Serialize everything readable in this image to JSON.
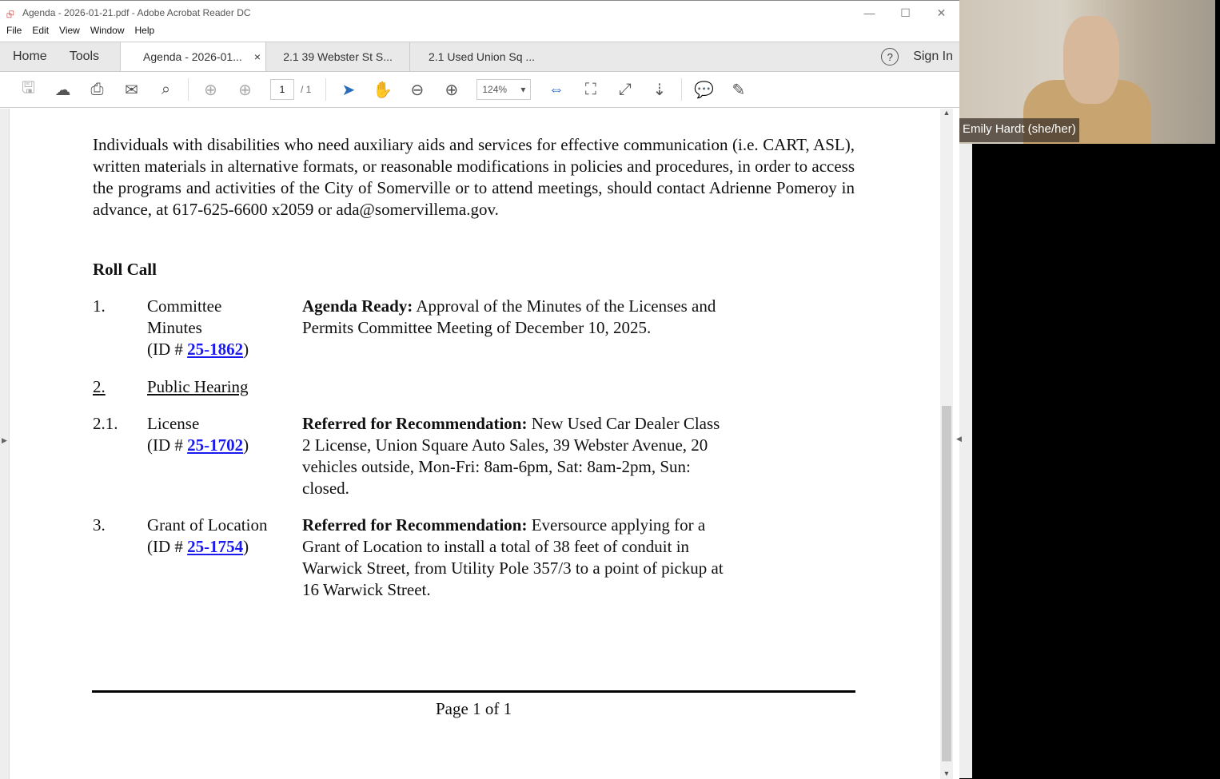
{
  "window": {
    "title": "Agenda - 2026-01-21.pdf - Adobe Acrobat Reader DC"
  },
  "menu": [
    "File",
    "Edit",
    "View",
    "Window",
    "Help"
  ],
  "tabs": {
    "home": "Home",
    "tools": "Tools",
    "docs": [
      "Agenda - 2026-01...",
      "2.1 39 Webster St S...",
      "2.1 Used Union Sq ..."
    ],
    "close": "×",
    "sign_in": "Sign In",
    "help": "?"
  },
  "toolbar": {
    "page_current": "1",
    "page_total": "/ 1",
    "zoom": "124%"
  },
  "doc": {
    "para": "Individuals with disabilities who need auxiliary aids and services for effective communication (i.e. CART, ASL), written materials in alternative formats, or reasonable modifications in policies and procedures, in order to access the programs and activities of the City of Somerville or to attend meetings, should contact Adrienne Pomeroy in advance, at 617-625-6600 x2059 or ada@somervillema.gov.",
    "roll_call": "Roll Call",
    "items": [
      {
        "num": "1.",
        "label1": "Committee",
        "label2": "Minutes",
        "id_prefix": "(ID # ",
        "id": "25-1862",
        "id_suffix": ")",
        "bold": "Agenda Ready:",
        "text": " Approval of the Minutes of the Licenses and Permits Committee Meeting of December 10, 2025."
      },
      {
        "num": "2.",
        "label": "Public Hearing"
      },
      {
        "num": "2.1.",
        "label1": "License",
        "id_prefix": "(ID # ",
        "id": "25-1702",
        "id_suffix": ")",
        "bold": "Referred for Recommendation:",
        "text": " New Used Car Dealer Class 2 License, Union Square Auto Sales, 39 Webster Avenue, 20 vehicles outside, Mon-Fri: 8am-6pm, Sat: 8am-2pm, Sun: closed."
      },
      {
        "num": "3.",
        "label1": "Grant of Location",
        "id_prefix": "(ID # ",
        "id": "25-1754",
        "id_suffix": ")",
        "bold": "Referred for Recommendation:",
        "text": " Eversource applying for a Grant of Location to install a total of 38 feet of conduit in Warwick Street, from Utility Pole 357/3 to a point of pickup at 16 Warwick Street."
      }
    ],
    "footer": "Page 1 of 1"
  },
  "video": {
    "name": "Emily Hardt (she/her)"
  }
}
